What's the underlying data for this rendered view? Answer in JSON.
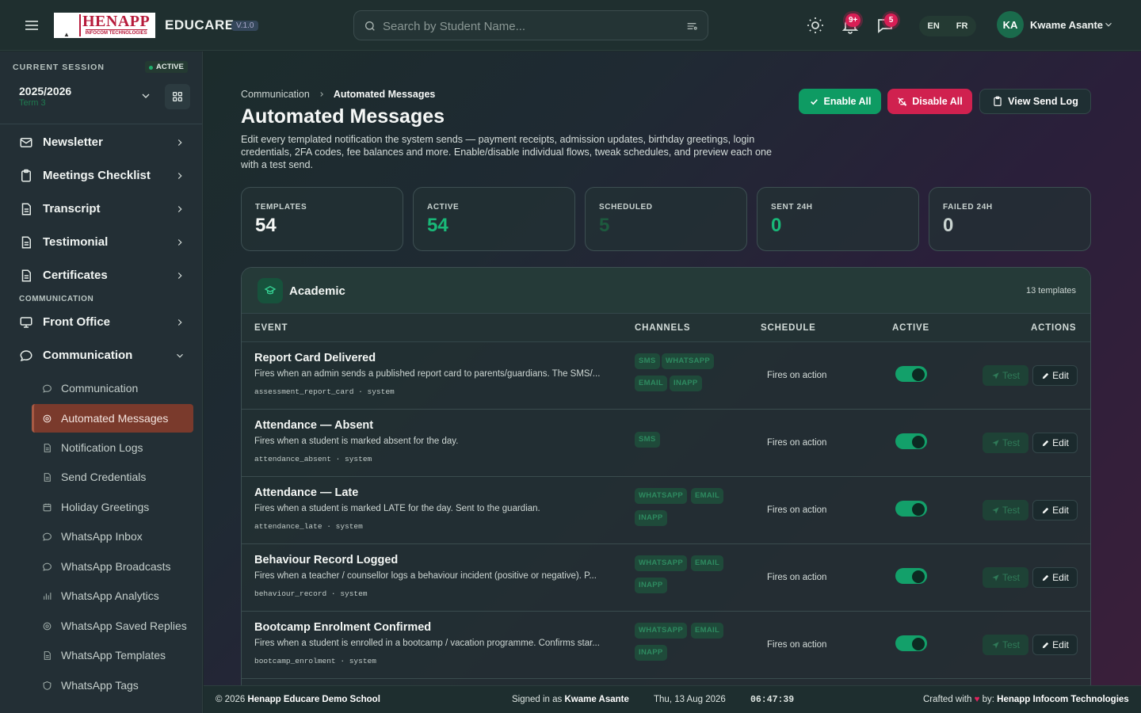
{
  "brand": {
    "logo_text": "HENAPP",
    "logo_sub": "INFOCOM TECHNOLOGIES",
    "name": "EDUCARE",
    "version": "V.1.0"
  },
  "search": {
    "placeholder": "Search by Student Name..."
  },
  "header": {
    "notif_count": "9+",
    "msg_count": "5",
    "lang_en": "EN",
    "lang_fr": "FR",
    "user_initials": "KA",
    "user_name": "Kwame Asante"
  },
  "session": {
    "label": "CURRENT SESSION",
    "status": "ACTIVE",
    "year": "2025/2026",
    "term": "Term 3"
  },
  "sidebar": {
    "items": [
      {
        "label": "Newsletter",
        "icon": "mail-icon"
      },
      {
        "label": "Meetings Checklist",
        "icon": "clipboard-icon"
      },
      {
        "label": "Transcript",
        "icon": "document-icon"
      },
      {
        "label": "Testimonial",
        "icon": "document-icon"
      },
      {
        "label": "Certificates",
        "icon": "document-icon"
      }
    ],
    "section_label": "COMMUNICATION",
    "front_office": "Front Office",
    "communication": "Communication",
    "subitems": [
      "Communication",
      "Automated Messages",
      "Notification Logs",
      "Send Credentials",
      "Holiday Greetings",
      "WhatsApp Inbox",
      "WhatsApp Broadcasts",
      "WhatsApp Analytics",
      "WhatsApp Saved Replies",
      "WhatsApp Templates",
      "WhatsApp Tags"
    ]
  },
  "page": {
    "crumb_parent": "Communication",
    "crumb_current": "Automated Messages",
    "title": "Automated Messages",
    "description": "Edit every templated notification the system sends — payment receipts, admission updates, birthday greetings, login credentials, 2FA codes, fee balances and more. Enable/disable individual flows, tweak schedules, and preview each one with a test send.",
    "btn_enable": "Enable All",
    "btn_disable": "Disable All",
    "btn_log": "View Send Log"
  },
  "stats": [
    {
      "label": "TEMPLATES",
      "value": "54",
      "color": "#f4f7f5"
    },
    {
      "label": "ACTIVE",
      "value": "54",
      "color": "#19b878"
    },
    {
      "label": "SCHEDULED",
      "value": "5",
      "color": "#1d5a3e"
    },
    {
      "label": "SENT 24H",
      "value": "0",
      "color": "#19b878"
    },
    {
      "label": "FAILED 24H",
      "value": "0",
      "color": "#c9d3d0"
    }
  ],
  "panel": {
    "title": "Academic",
    "count": "13 templates"
  },
  "table": {
    "headers": {
      "event": "EVENT",
      "channels": "CHANNELS",
      "schedule": "SCHEDULE",
      "active": "ACTIVE",
      "actions": "ACTIONS"
    }
  },
  "rows": [
    {
      "name": "Report Card Delivered",
      "desc": "Fires when an admin sends a published report card to parents/guardians. The SMS/...",
      "key": "assessment_report_card · system",
      "channels": [
        "SMS",
        "WHATSAPP",
        "EMAIL",
        "INAPP"
      ],
      "schedule": "Fires on action",
      "active": true
    },
    {
      "name": "Attendance — Absent",
      "desc": "Fires when a student is marked absent for the day.",
      "key": "attendance_absent · system",
      "channels": [
        "SMS"
      ],
      "schedule": "Fires on action",
      "active": true
    },
    {
      "name": "Attendance — Late",
      "desc": "Fires when a student is marked LATE for the day. Sent to the guardian.",
      "key": "attendance_late · system",
      "channels": [
        "WHATSAPP",
        "EMAIL",
        "INAPP"
      ],
      "schedule": "Fires on action",
      "active": true
    },
    {
      "name": "Behaviour Record Logged",
      "desc": "Fires when a teacher / counsellor logs a behaviour incident (positive or negative). P...",
      "key": "behaviour_record · system",
      "channels": [
        "WHATSAPP",
        "EMAIL",
        "INAPP"
      ],
      "schedule": "Fires on action",
      "active": true
    },
    {
      "name": "Bootcamp Enrolment Confirmed",
      "desc": "Fires when a student is enrolled in a bootcamp / vacation programme. Confirms star...",
      "key": "bootcamp_enrolment · system",
      "channels": [
        "WHATSAPP",
        "EMAIL",
        "INAPP"
      ],
      "schedule": "Fires on action",
      "active": true
    }
  ],
  "actions": {
    "test": "Test",
    "edit": "Edit"
  },
  "footer": {
    "copyright": "© 2026",
    "school": "Henapp Educare Demo School",
    "signed_prefix": "Signed in as",
    "signed_user": "Kwame Asante",
    "date": "Thu, 13 Aug 2026",
    "time": "06:47:39",
    "crafted": "Crafted with",
    "by": "by:",
    "company": "Henapp Infocom Technologies"
  }
}
